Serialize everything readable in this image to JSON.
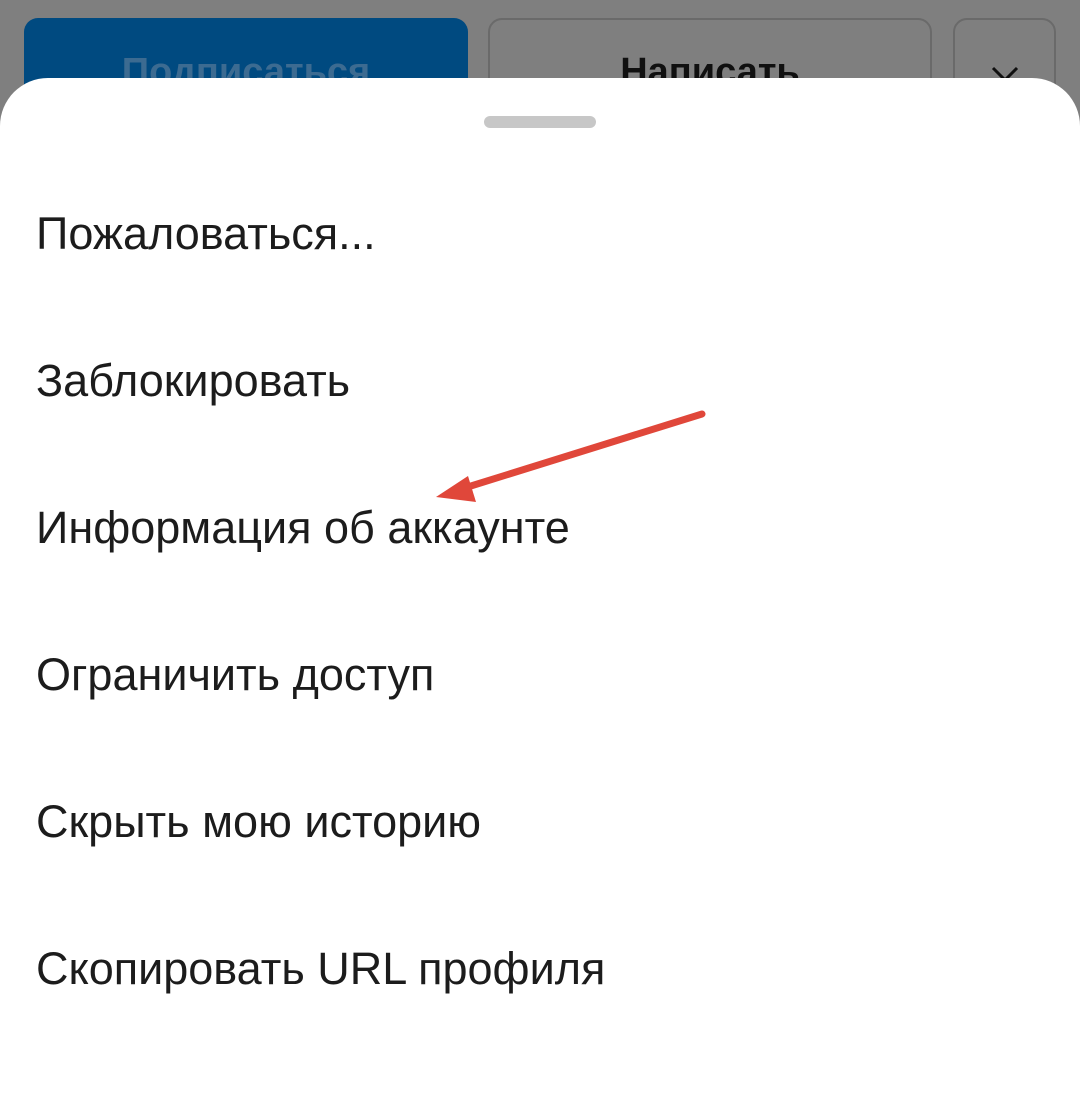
{
  "background_actions": {
    "subscribe_label": "Подписаться",
    "message_label": "Написать",
    "more_icon": "chevron-down-icon"
  },
  "sheet": {
    "handle_icon": "drag-handle",
    "items": [
      {
        "label": "Пожаловаться..."
      },
      {
        "label": "Заблокировать"
      },
      {
        "label": "Информация об аккаунте"
      },
      {
        "label": "Ограничить доступ"
      },
      {
        "label": "Скрыть мою историю"
      },
      {
        "label": "Скопировать URL профиля"
      }
    ]
  },
  "annotation": {
    "arrow_color": "#e0473a",
    "points_to": "Информация об аккаунте"
  },
  "colors": {
    "overlay": "#7f7f7f",
    "subscribe_button": "#004a80",
    "sheet_background": "#ffffff",
    "text": "#1c1c1c"
  }
}
